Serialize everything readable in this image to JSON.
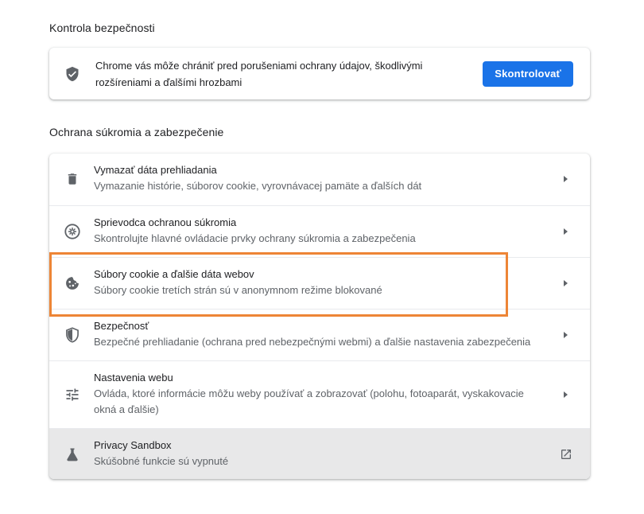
{
  "safety_check": {
    "section_title": "Kontrola bezpečnosti",
    "description": "Chrome vás môže chrániť pred porušeniami ochrany údajov, škodlivými rozšíreniami a ďalšími hrozbami",
    "button_label": "Skontrolovať",
    "icon": "shield-check-icon"
  },
  "privacy": {
    "section_title": "Ochrana súkromia a zabezpečenie",
    "items": [
      {
        "label": "Vymazať dáta prehliadania",
        "sublabel": "Vymazanie histórie, súborov cookie, vyrovnávacej pamäte a ďalších dát",
        "icon": "trash-icon",
        "action": "chevron-right-icon"
      },
      {
        "label": "Sprievodca ochranou súkromia",
        "sublabel": "Skontrolujte hlavné ovládacie prvky ochrany súkromia a zabezpečenia",
        "icon": "compass-icon",
        "action": "chevron-right-icon"
      },
      {
        "label": "Súbory cookie a ďalšie dáta webov",
        "sublabel": "Súbory cookie tretích strán sú v anonymnom režime blokované",
        "icon": "cookie-icon",
        "action": "chevron-right-icon"
      },
      {
        "label": "Bezpečnosť",
        "sublabel": "Bezpečné prehliadanie (ochrana pred nebezpečnými webmi) a ďalšie nastavenia zabezpečenia",
        "icon": "shield-icon",
        "action": "chevron-right-icon"
      },
      {
        "label": "Nastavenia webu",
        "sublabel": "Ovláda, ktoré informácie môžu weby používať a zobrazovať (polohu, fotoaparát, vyskakovacie okná a ďalšie)",
        "icon": "sliders-icon",
        "action": "chevron-right-icon"
      },
      {
        "label": "Privacy Sandbox",
        "sublabel": "Skúšobné funkcie sú vypnuté",
        "icon": "flask-icon",
        "action": "open-in-new-icon"
      }
    ]
  },
  "colors": {
    "accent": "#1a73e8",
    "highlight": "#ed8536",
    "icon": "#5f6368",
    "sandbox_row_bg": "#e8e8e9"
  }
}
